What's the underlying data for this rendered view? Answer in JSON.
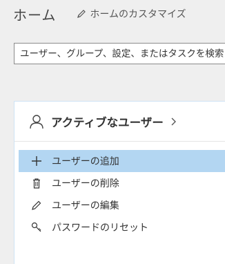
{
  "header": {
    "title": "ホーム",
    "customize_label": "ホームのカスタマイズ"
  },
  "search": {
    "placeholder": "ユーザー、グループ、設定、またはタスクを検索"
  },
  "card": {
    "title": "アクティブなユーザー",
    "items": [
      {
        "label": "ユーザーの追加",
        "icon": "plus-icon",
        "selected": true
      },
      {
        "label": "ユーザーの削除",
        "icon": "trash-icon",
        "selected": false
      },
      {
        "label": "ユーザーの編集",
        "icon": "pencil-icon",
        "selected": false
      },
      {
        "label": "パスワードのリセット",
        "icon": "key-icon",
        "selected": false
      }
    ]
  },
  "colors": {
    "background": "#efefef",
    "selected_item": "#b3d6f2",
    "card_border": "#cfe3f4"
  }
}
